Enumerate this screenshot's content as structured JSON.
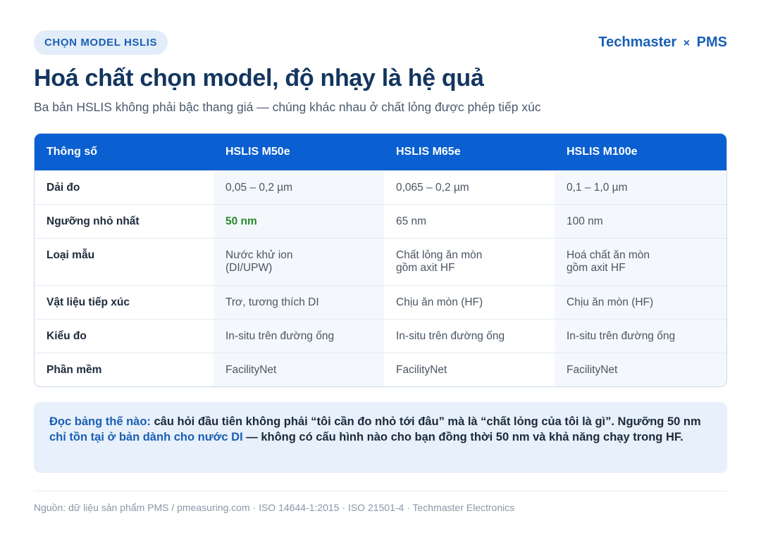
{
  "header": {
    "tag": "CHỌN MODEL HSLIS",
    "brand_left": "Techmaster",
    "brand_sep": "×",
    "brand_right": "PMS"
  },
  "title": "Hoá chất chọn model, độ nhạy là hệ quả",
  "subtitle": "Ba bản HSLIS không phải bậc thang giá — chúng khác nhau ở chất lỏng được phép tiếp xúc",
  "table": {
    "headers": [
      "Thông số",
      "HSLIS M50e",
      "HSLIS M65e",
      "HSLIS M100e"
    ],
    "rows": [
      {
        "label": "Dải đo",
        "c1": "0,05 – 0,2 µm",
        "c2": "0,065 – 0,2 µm",
        "c3": "0,1 – 1,0 µm"
      },
      {
        "label": "Ngưỡng nhỏ nhất",
        "c1": "50 nm",
        "c2": "65 nm",
        "c3": "100 nm"
      },
      {
        "label": "Loại mẫu",
        "c1a": "Nước khử ion",
        "c1b": "(DI/UPW)",
        "c2a": "Chất lỏng ăn mòn",
        "c2b": "gồm axit HF",
        "c3a": "Hoá chất ăn mòn",
        "c3b": "gồm axit HF"
      },
      {
        "label": "Vật liệu tiếp xúc",
        "c1": "Trơ, tương thích DI",
        "c2": "Chịu ăn mòn (HF)",
        "c3": "Chịu ăn mòn (HF)"
      },
      {
        "label": "Kiểu đo",
        "c1": "In-situ trên đường ống",
        "c2": "In-situ trên đường ống",
        "c3": "In-situ trên đường ống"
      },
      {
        "label": "Phần mềm",
        "c1": "FacilityNet",
        "c2": "FacilityNet",
        "c3": "FacilityNet"
      }
    ]
  },
  "note": {
    "lead": "Đọc bảng thế nào:",
    "text1": " câu hỏi đầu tiên không phải “tôi cần đo nhỏ tới đâu” mà là “chất lỏng của tôi là gì”. Ngưỡng 50 nm ",
    "highlight": "chỉ tồn tại ở bản dành cho nước DI",
    "text2": " — không có cấu hình nào cho bạn đồng thời 50 nm và khả năng chạy trong HF."
  },
  "footer": "Nguồn: dữ liệu sản phẩm PMS / pmeasuring.com · ISO 14644-1:2015 · ISO 21501-4 · Techmaster Electronics",
  "colors": {
    "accent": "#0a5fd1",
    "title": "#13365f",
    "green": "#2a8a2e"
  }
}
